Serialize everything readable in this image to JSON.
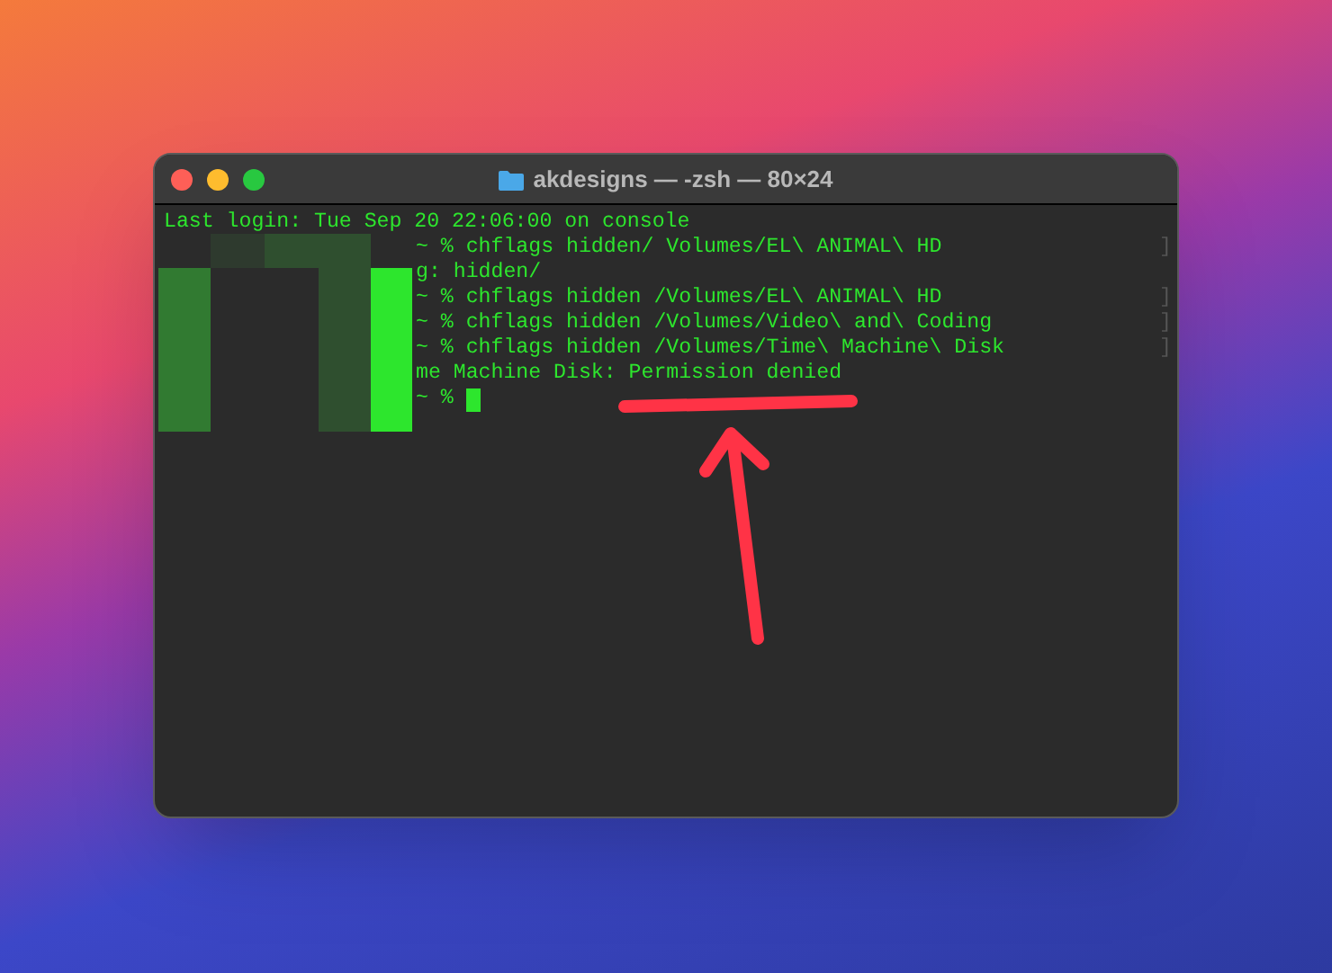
{
  "window": {
    "title": "akdesigns — -zsh — 80×24"
  },
  "terminal": {
    "lines": [
      {
        "kind": "full",
        "text": "Last login: Tue Sep 20 22:06:00 on console"
      },
      {
        "kind": "redacted",
        "text": "~ % chflags hidden/ Volumes/EL\\ ANIMAL\\ HD",
        "right_mark": "]"
      },
      {
        "kind": "redacted",
        "text": "g: hidden/"
      },
      {
        "kind": "redacted",
        "text": "~ % chflags hidden /Volumes/EL\\ ANIMAL\\ HD",
        "right_mark": "]"
      },
      {
        "kind": "redacted",
        "text": "~ % chflags hidden /Volumes/Video\\ and\\ Coding",
        "right_mark": "]"
      },
      {
        "kind": "redacted",
        "text": "~ % chflags hidden /Volumes/Time\\ Machine\\ Disk",
        "right_mark": "]"
      },
      {
        "kind": "redacted",
        "text": "me Machine Disk: Permission denied"
      },
      {
        "kind": "prompt",
        "text": "~ %"
      }
    ]
  }
}
